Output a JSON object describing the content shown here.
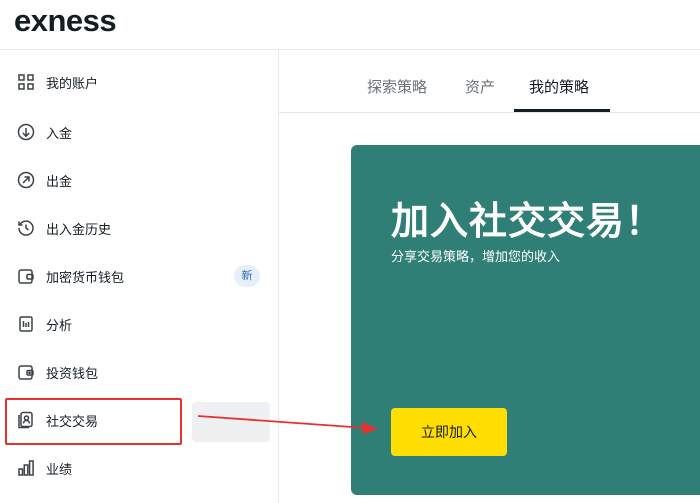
{
  "header": {
    "logo": "exness"
  },
  "sidebar": {
    "items": [
      {
        "label": "我的账户",
        "icon": "dashboard-grid-icon"
      },
      {
        "label": "入金",
        "icon": "deposit-arrow-down-icon"
      },
      {
        "label": "出金",
        "icon": "withdraw-arrow-up-icon"
      },
      {
        "label": "出入金历史",
        "icon": "history-icon"
      },
      {
        "label": "加密货币钱包",
        "icon": "crypto-wallet-icon",
        "badge": "新"
      },
      {
        "label": "分析",
        "icon": "analytics-icon"
      },
      {
        "label": "投资钱包",
        "icon": "investment-wallet-icon"
      },
      {
        "label": "社交交易",
        "icon": "social-trading-icon"
      },
      {
        "label": "业绩",
        "icon": "performance-bar-chart-icon"
      }
    ]
  },
  "tabs": [
    {
      "label": "探索策略"
    },
    {
      "label": "资产"
    },
    {
      "label": "我的策略"
    }
  ],
  "active_tab": "我的策略",
  "banner": {
    "title": "加入社交交易！",
    "subtitle": "分享交易策略，增加您的收入",
    "button_label": "立即加入"
  },
  "colors": {
    "banner_bg": "#2f7f76",
    "button_bg": "#ffde02",
    "annotation_red": "#e8302f",
    "badge_bg": "#e6f0fa"
  }
}
